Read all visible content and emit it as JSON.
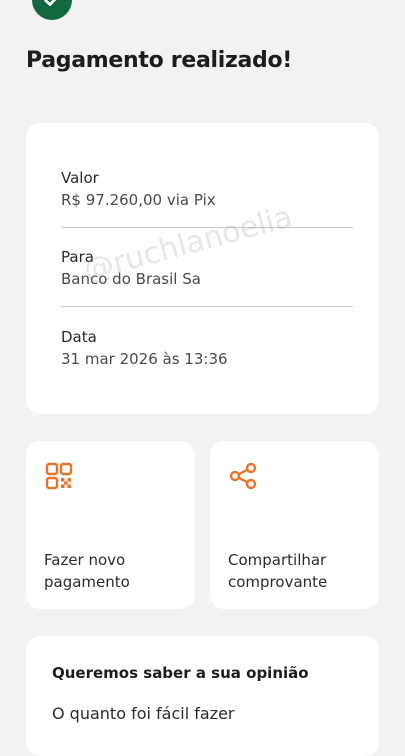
{
  "header": {
    "title": "Pagamento realizado!"
  },
  "details": {
    "items": [
      {
        "label": "Valor",
        "value": "R$ 97.260,00 via Pix"
      },
      {
        "label": "Para",
        "value": "Banco do Brasil Sa"
      },
      {
        "label": "Data",
        "value": "31 mar 2026 às 13:36"
      }
    ]
  },
  "actions": [
    {
      "line1": "Fazer novo",
      "line2": "pagamento",
      "icon": "qr-code-icon"
    },
    {
      "line1": "Compartilhar",
      "line2": "comprovante",
      "icon": "share-icon"
    }
  ],
  "survey": {
    "heading": "Queremos saber a sua opinião",
    "question": "O quanto foi fácil fazer"
  },
  "watermark": "@ruchlanoelia",
  "colors": {
    "accent": "#e8742a",
    "success": "#13693f",
    "background": "#f2f2f3",
    "card": "#ffffff"
  }
}
